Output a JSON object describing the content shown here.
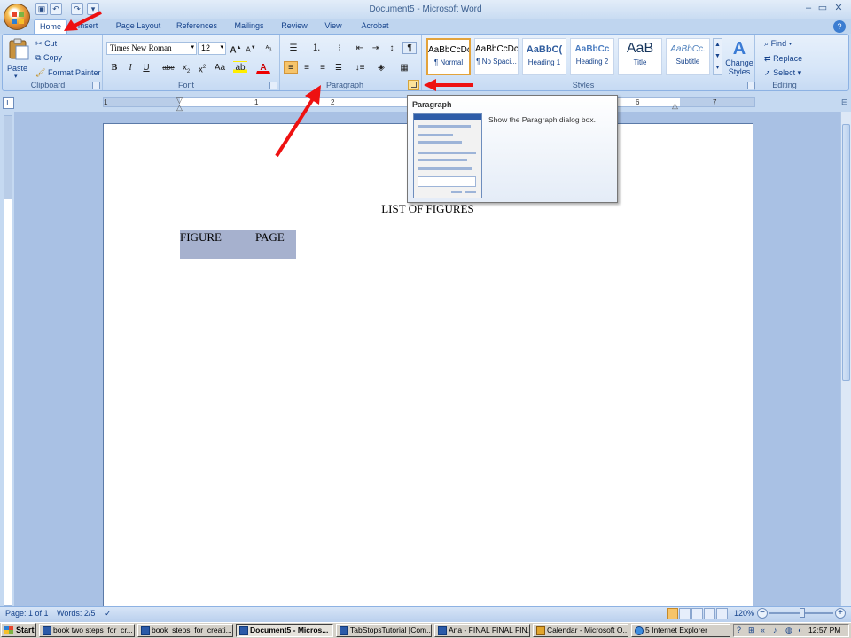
{
  "window": {
    "title": "Document5 - Microsoft Word",
    "controls": {
      "minimize": "–",
      "maximize": "▭",
      "close": "✕"
    }
  },
  "quick_access": [
    "save-icon",
    "undo-icon",
    "redo-icon",
    "customize-icon"
  ],
  "tabs": [
    "Home",
    "Insert",
    "Page Layout",
    "References",
    "Mailings",
    "Review",
    "View",
    "Acrobat"
  ],
  "active_tab": "Home",
  "ribbon": {
    "clipboard": {
      "label": "Clipboard",
      "paste": "Paste",
      "cut": "Cut",
      "copy": "Copy",
      "format_painter": "Format Painter"
    },
    "font": {
      "label": "Font",
      "family": "Times New Roman",
      "size": "12",
      "aa": "Aa"
    },
    "paragraph": {
      "label": "Paragraph"
    },
    "styles": {
      "label": "Styles",
      "tiles": [
        {
          "sample": "AaBbCcDc",
          "name": "¶ Normal"
        },
        {
          "sample": "AaBbCcDc",
          "name": "¶ No Spaci..."
        },
        {
          "sample": "AaBbC(",
          "name": "Heading 1"
        },
        {
          "sample": "AaBbCc",
          "name": "Heading 2"
        },
        {
          "sample": "AaB",
          "name": "Title"
        },
        {
          "sample": "AaBbCc.",
          "name": "Subtitle"
        }
      ],
      "change_styles": "Change Styles"
    },
    "editing": {
      "label": "Editing",
      "find": "Find",
      "replace": "Replace",
      "select": "Select"
    }
  },
  "ruler": {
    "numbers": [
      "1",
      "1",
      "2",
      "6",
      "7"
    ]
  },
  "tooltip": {
    "title": "Paragraph",
    "description": "Show the Paragraph dialog box."
  },
  "document": {
    "heading": "LIST OF FIGURES",
    "row": {
      "left": "FIGURE",
      "right": "PAGE"
    }
  },
  "status": {
    "page": "Page: 1 of 1",
    "words": "Words: 2/5",
    "zoom": "120%"
  },
  "taskbar": {
    "start": "Start",
    "tasks": [
      "book two steps_for_cr...",
      "book_steps_for_creati...",
      "Document5 - Micros...",
      "TabStopsTutorial [Com...",
      "Ana - FINAL FINAL FIN...",
      "Calendar - Microsoft O...",
      "5 Internet Explorer"
    ],
    "clock": "12:57 PM"
  },
  "colors": {
    "annotation_arrow": "#ee1111",
    "ribbon_text": "#15428b",
    "selection": "#a6b1ce"
  }
}
